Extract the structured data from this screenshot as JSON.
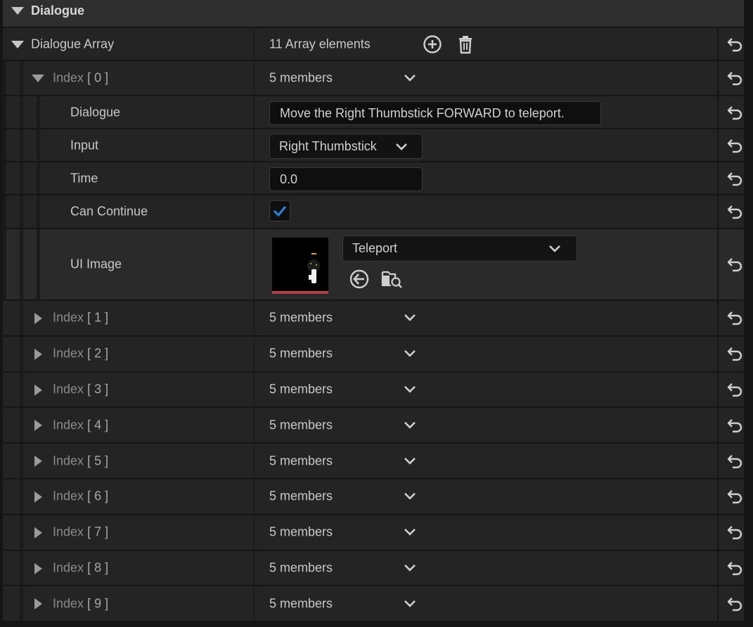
{
  "category": {
    "title": "Dialogue"
  },
  "array": {
    "label": "Dialogue Array",
    "count_text": "11 Array elements"
  },
  "expanded": {
    "label": "Index",
    "index": "[ 0 ]",
    "members": "5 members",
    "fields": {
      "dialogue_label": "Dialogue",
      "dialogue_value": "Move the Right Thumbstick FORWARD to teleport.",
      "input_label": "Input",
      "input_value": "Right Thumbstick",
      "time_label": "Time",
      "time_value": "0.0",
      "can_continue_label": "Can Continue",
      "can_continue_checked": true,
      "ui_image_label": "UI Image",
      "ui_image_asset": "Teleport"
    }
  },
  "collapsed": [
    {
      "label": "Index",
      "index": "[ 1 ]",
      "members": "5 members"
    },
    {
      "label": "Index",
      "index": "[ 2 ]",
      "members": "5 members"
    },
    {
      "label": "Index",
      "index": "[ 3 ]",
      "members": "5 members"
    },
    {
      "label": "Index",
      "index": "[ 4 ]",
      "members": "5 members"
    },
    {
      "label": "Index",
      "index": "[ 5 ]",
      "members": "5 members"
    },
    {
      "label": "Index",
      "index": "[ 6 ]",
      "members": "5 members"
    },
    {
      "label": "Index",
      "index": "[ 7 ]",
      "members": "5 members"
    },
    {
      "label": "Index",
      "index": "[ 8 ]",
      "members": "5 members"
    },
    {
      "label": "Index",
      "index": "[ 9 ]",
      "members": "5 members"
    }
  ],
  "colors": {
    "background": "#151515",
    "row": "#242424",
    "checkbox_accent": "#2f7fd8",
    "thumbnail_bar": "#b0404a"
  },
  "icons": [
    "triangle-down-icon",
    "triangle-right-icon",
    "add-circle-icon",
    "trash-icon",
    "chevron-down-icon",
    "reset-arrow-icon",
    "checkmark-icon",
    "navigate-back-icon",
    "browse-folder-icon"
  ]
}
